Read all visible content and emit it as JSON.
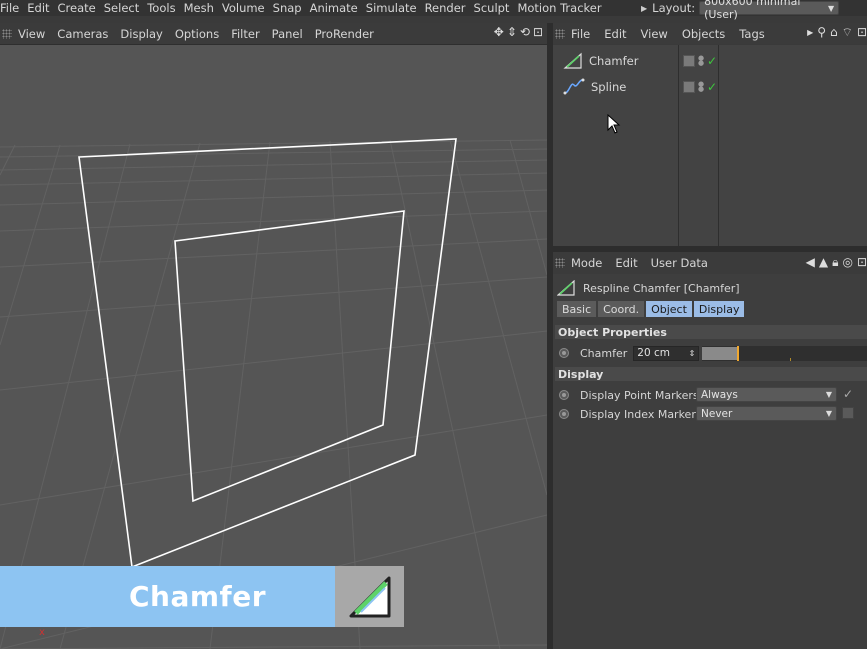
{
  "menubar": {
    "items": [
      "File",
      "Edit",
      "Create",
      "Select",
      "Tools",
      "Mesh",
      "Volume",
      "Snap",
      "Animate",
      "Simulate",
      "Render",
      "Sculpt",
      "Motion Tracker"
    ],
    "layout_label": "Layout:",
    "layout_value": "800x600 minimal (User)"
  },
  "viewport": {
    "menu": [
      "View",
      "Cameras",
      "Display",
      "Options",
      "Filter",
      "Panel",
      "ProRender"
    ],
    "axis_label": "x"
  },
  "object_manager": {
    "menu": [
      "File",
      "Edit",
      "View",
      "Objects",
      "Tags"
    ],
    "objects": [
      {
        "name": "Chamfer",
        "icon": "chamfer-icon"
      },
      {
        "name": "Spline",
        "icon": "spline-icon"
      }
    ]
  },
  "attribute_manager": {
    "menu": [
      "Mode",
      "Edit",
      "User Data"
    ],
    "title": "Respline Chamfer [Chamfer]",
    "tabs": [
      {
        "label": "Basic",
        "active": false
      },
      {
        "label": "Coord.",
        "active": false
      },
      {
        "label": "Object",
        "active": true
      },
      {
        "label": "Display",
        "active": true
      }
    ],
    "sections": {
      "object_properties": "Object Properties",
      "display": "Display"
    },
    "chamfer": {
      "label": "Chamfer",
      "value": "20 cm",
      "slider_fraction": 0.2
    },
    "point_markers": {
      "label": "Display Point Markers",
      "value": "Always",
      "checked": true
    },
    "index_markers": {
      "label": "Display Index Markers",
      "value": "Never",
      "checked": false
    }
  },
  "banner": {
    "title": "Chamfer"
  },
  "colors": {
    "accent": "#8dc4f2",
    "tab_active": "#9bbce6",
    "check": "#3ec83e",
    "slider_knob": "#f0a830"
  }
}
